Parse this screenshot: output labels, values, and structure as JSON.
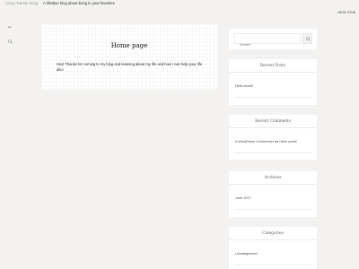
{
  "header": {
    "site_title": "Crazy Twenty Song",
    "tagline": "A lifestlye blog about living in your favorites",
    "new_item": "NEW ITEM"
  },
  "main": {
    "title": "Home page",
    "body": "Hey! Thanks for coming to my blog and learning about my life and how I can help your life also"
  },
  "sidebar": {
    "search": {
      "placeholder": "Search"
    },
    "recent_posts": {
      "title": "Recent Posts",
      "items": [
        "Hello world!"
      ]
    },
    "recent_comments": {
      "title": "Recent Comments",
      "author": "A WordPress Commenter",
      "on_text": "on",
      "post": "Hello world!"
    },
    "archives": {
      "title": "Archives",
      "items": [
        "June 2017"
      ]
    },
    "categories": {
      "title": "Categories",
      "items": [
        "Uncategorized"
      ]
    }
  },
  "icons": {
    "left_top": "more-icon",
    "left_second": "search-icon",
    "search_button": "search-icon"
  }
}
